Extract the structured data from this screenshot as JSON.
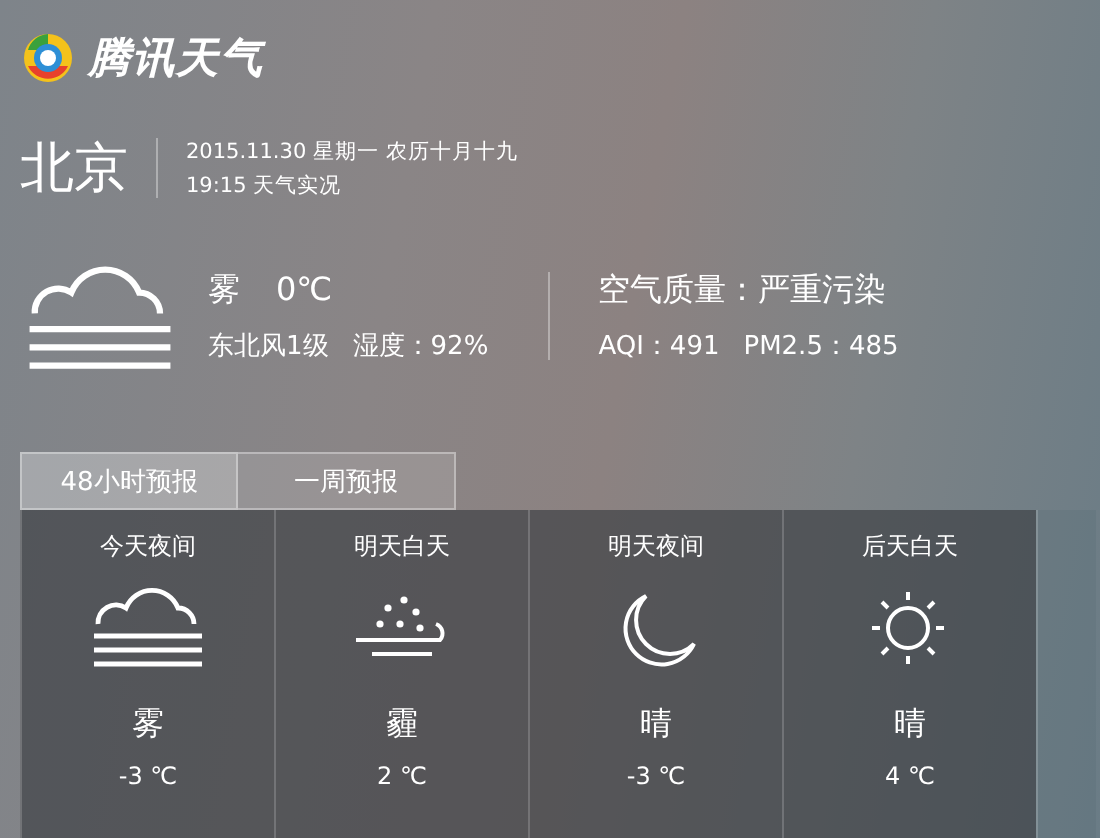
{
  "app": {
    "name": "腾讯天气"
  },
  "location": {
    "city": "北京",
    "date_line": "2015.11.30 星期一 农历十月十九",
    "time_line": "19:15 天气实况"
  },
  "current": {
    "kind": "fog",
    "condition": "雾",
    "temperature": "0℃",
    "wind": "东北风1级",
    "humidity": "湿度：92%"
  },
  "air": {
    "quality": "空气质量：严重污染",
    "aqi": "AQI：491",
    "pm25": "PM2.5：485"
  },
  "tabs": [
    {
      "label": "48小时预报",
      "selected": true
    },
    {
      "label": "一周预报",
      "selected": false
    }
  ],
  "forecast": [
    {
      "period": "今天夜间",
      "kind": "fog",
      "condition": "雾",
      "temperature": "-3 ℃"
    },
    {
      "period": "明天白天",
      "kind": "haze",
      "condition": "霾",
      "temperature": "2 ℃"
    },
    {
      "period": "明天夜间",
      "kind": "moon",
      "condition": "晴",
      "temperature": "-3 ℃"
    },
    {
      "period": "后天白天",
      "kind": "sun",
      "condition": "晴",
      "temperature": "4 ℃"
    }
  ]
}
